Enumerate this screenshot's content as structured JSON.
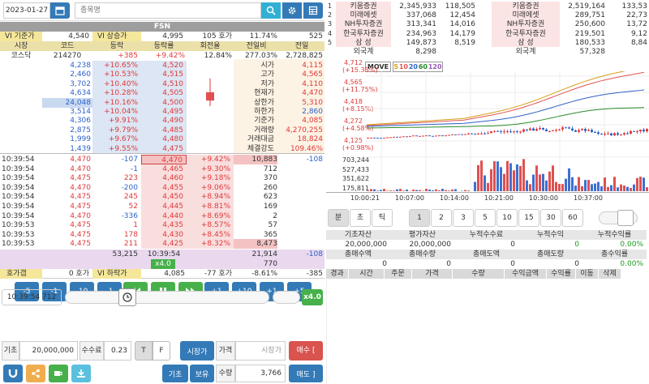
{
  "top": {
    "date": "2023-01-27",
    "search_placeholder": "종목명"
  },
  "symbol": "FSN",
  "info": {
    "vi_base_label": "VI 기준가",
    "vi_base": "4,540",
    "vi_up_label": "VI 상승가",
    "vi_up": "4,995",
    "hoga_cnt": "105 호가",
    "pct": "11.74%",
    "val": "525"
  },
  "hdr": [
    "시장",
    "코드",
    "등락",
    "등락률",
    "회전율",
    "전일비",
    "전일"
  ],
  "mkt": {
    "market": "코스닥",
    "code": "214270",
    "chg": "+385",
    "rate": "+9.42%",
    "turn": "12.84%",
    "prev_rate": "277.03%",
    "prev": "2,728,825"
  },
  "asks": [
    {
      "vol": "4,238",
      "rate": "+10.65%",
      "price": "4,520"
    },
    {
      "vol": "2,460",
      "rate": "+10.53%",
      "price": "4,515"
    },
    {
      "vol": "3,702",
      "rate": "+10.40%",
      "price": "4,510"
    },
    {
      "vol": "4,634",
      "rate": "+10.28%",
      "price": "4,505"
    },
    {
      "vol": "24,048",
      "rate": "+10.16%",
      "price": "4,500"
    },
    {
      "vol": "3,514",
      "rate": "+10.04%",
      "price": "4,495"
    },
    {
      "vol": "4,306",
      "rate": "+9.91%",
      "price": "4,490"
    },
    {
      "vol": "2,875",
      "rate": "+9.79%",
      "price": "4,485"
    },
    {
      "vol": "1,999",
      "rate": "+9.67%",
      "price": "4,480"
    },
    {
      "vol": "1,439",
      "rate": "+9.55%",
      "price": "4,475"
    }
  ],
  "stats": [
    {
      "label": "시가",
      "value": "4,115"
    },
    {
      "label": "고가",
      "value": "4,565"
    },
    {
      "label": "저가",
      "value": "4,110"
    },
    {
      "label": "현재가",
      "value": "4,470"
    },
    {
      "label": "상한가",
      "value": "5,310"
    },
    {
      "label": "하한가",
      "value": "2,860"
    },
    {
      "label": "기준가",
      "value": "4,085"
    },
    {
      "label": "거래량",
      "value": "4,270,255"
    },
    {
      "label": "거래대금",
      "value": "18,824"
    },
    {
      "label": "체결강도",
      "value": "109.46%"
    }
  ],
  "ticks": [
    {
      "time": "10:39:54",
      "price": "4,470",
      "qty": "-107"
    },
    {
      "time": "10:39:54",
      "price": "4,470",
      "qty": "-1"
    },
    {
      "time": "10:39:54",
      "price": "4,475",
      "qty": "223"
    },
    {
      "time": "10:39:54",
      "price": "4,470",
      "qty": "-200"
    },
    {
      "time": "10:39:54",
      "price": "4,475",
      "qty": "245"
    },
    {
      "time": "10:39:54",
      "price": "4,475",
      "qty": "52"
    },
    {
      "time": "10:39:54",
      "price": "4,470",
      "qty": "-336"
    },
    {
      "time": "10:39:53",
      "price": "4,475",
      "qty": "1"
    },
    {
      "time": "10:39:53",
      "price": "4,475",
      "qty": "178"
    },
    {
      "time": "10:39:53",
      "price": "4,475",
      "qty": "211"
    }
  ],
  "bids": [
    {
      "price": "4,470",
      "rate": "+9.42%",
      "vol": "10,883",
      "extra": "-108"
    },
    {
      "price": "4,465",
      "rate": "+9.30%",
      "vol": "712"
    },
    {
      "price": "4,460",
      "rate": "+9.18%",
      "vol": "370"
    },
    {
      "price": "4,455",
      "rate": "+9.06%",
      "vol": "260"
    },
    {
      "price": "4,450",
      "rate": "+8.94%",
      "vol": "623"
    },
    {
      "price": "4,445",
      "rate": "+8.81%",
      "vol": "169"
    },
    {
      "price": "4,440",
      "rate": "+8.69%",
      "vol": "2"
    },
    {
      "price": "4,435",
      "rate": "+8.57%",
      "vol": "57"
    },
    {
      "price": "4,430",
      "rate": "+8.45%",
      "vol": "365"
    },
    {
      "price": "4,425",
      "rate": "+8.32%",
      "vol": "8,473"
    }
  ],
  "totals": {
    "ask_total": "53,215",
    "time": "10:39:54",
    "speed": "x4.0",
    "bid_total": "21,914",
    "diff": "-108",
    "bid_extra": "770"
  },
  "bottom_row": {
    "cap_label": "호가갭",
    "cap": "0 호가",
    "vi_down_label": "VI 하락가",
    "vi_down": "4,085",
    "hoga": "-77 호가",
    "pct": "-8.61%",
    "val": "-385"
  },
  "ctrl_row1": [
    "-5",
    "-1",
    "-10",
    "-1",
    "+1",
    "+10",
    "+1",
    "+5"
  ],
  "play": {
    "time": "10:39:54 712",
    "speed": "x4.0"
  },
  "form": {
    "base_label": "기초",
    "base_value": "20,000,000",
    "fee_label": "수수료",
    "fee_value": "0.23",
    "t": "T",
    "f": "F",
    "market_btn": "시장가",
    "price_label": "가격",
    "price_placeholder": "시장가",
    "buy": "매수 [",
    "qty_label": "수량",
    "qty_value": "3,766",
    "sell": "매도 ]",
    "base_btn": "기초",
    "hold_btn": "보유"
  },
  "brokers": [
    {
      "no": "1",
      "sell_name": "키움증권",
      "sv": "2,345,933",
      "sv2": "118,505",
      "buy_name": "키움증권",
      "bv": "2,519,164",
      "bv2": "133,53"
    },
    {
      "no": "2",
      "sell_name": "미래에셋",
      "sv": "337,068",
      "sv2": "12,454",
      "buy_name": "미래에셋",
      "bv": "289,751",
      "bv2": "22,73"
    },
    {
      "no": "3",
      "sell_name": "NH투자증권",
      "sv": "313,341",
      "sv2": "14,016",
      "buy_name": "NH투자증권",
      "bv": "250,600",
      "bv2": "13,72"
    },
    {
      "no": "4",
      "sell_name": "한국투자증권",
      "sv": "234,963",
      "sv2": "14,179",
      "buy_name": "한국투자증권",
      "bv": "219,501",
      "bv2": "9,12"
    },
    {
      "no": "5",
      "sell_name": "삼 성",
      "sv": "149,873",
      "sv2": "8,519",
      "buy_name": "삼 성",
      "bv": "180,533",
      "bv2": "8,84"
    },
    {
      "no": "",
      "sell_name": "외국계",
      "sv": "8,298",
      "sv2": "",
      "buy_name": "외국계",
      "bv": "57,328",
      "bv2": ""
    }
  ],
  "chart_labels": {
    "move": "MOVE",
    "ma": [
      "5",
      "10",
      "20",
      "60",
      "120"
    ],
    "ma_colors": [
      "#d4a017",
      "#e05555",
      "#2f62c9",
      "#2a8a2a",
      "#9b59b6"
    ]
  },
  "chart_data": {
    "type": "candlestick",
    "price_axis": [
      {
        "price": "4,712",
        "pct": "(+15.35%)"
      },
      {
        "price": "4,565",
        "pct": "(+11.75%)"
      },
      {
        "price": "4,418",
        "pct": "(+8.15%)"
      },
      {
        "price": "4,272",
        "pct": "(+4.58%)"
      },
      {
        "price": "4,125",
        "pct": "(+0.98%)"
      }
    ],
    "volume_axis": [
      "703,244",
      "527,433",
      "351,622",
      "175,811"
    ],
    "x_labels": [
      "10:00:21",
      "10:07:00",
      "10:14:00",
      "10:21:00",
      "10:30:00",
      "10:37:00"
    ],
    "mini_candle": {
      "open": 4500,
      "close": 4440,
      "high": 4600,
      "low": 4400
    }
  },
  "chart_tabs": {
    "types": [
      "분",
      "초",
      "틱"
    ],
    "periods": [
      "1",
      "2",
      "3",
      "5",
      "10",
      "15",
      "30",
      "60"
    ]
  },
  "account": {
    "h1": [
      "기초자산",
      "평가자산",
      "누적수수료",
      "누적수익",
      "누적수익률"
    ],
    "v1": [
      "20,000,000",
      "20,000,000",
      "0",
      "0",
      "0.00%"
    ],
    "h2": [
      "총매수액",
      "총매수량",
      "총매도액",
      "총매도량",
      "총수익률"
    ],
    "v2": [
      "0",
      "0",
      "0",
      "0",
      "0.00%"
    ],
    "h3": [
      "경과",
      "시간",
      "주문",
      "가격",
      "수량",
      "수익금액",
      "수익률",
      "이동",
      "삭제"
    ]
  }
}
